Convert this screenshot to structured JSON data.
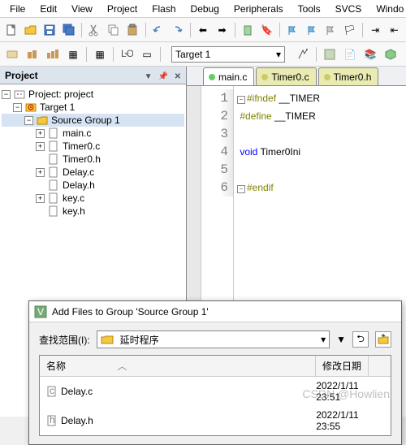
{
  "menu": [
    "File",
    "Edit",
    "View",
    "Project",
    "Flash",
    "Debug",
    "Peripherals",
    "Tools",
    "SVCS",
    "Windo"
  ],
  "target_label": "Target 1",
  "project_panel_title": "Project",
  "tree": {
    "root": "Project: project",
    "target": "Target 1",
    "group": "Source Group 1",
    "files": [
      "main.c",
      "Timer0.c",
      "Timer0.h",
      "Delay.c",
      "Delay.h",
      "key.c",
      "key.h"
    ]
  },
  "tabs": [
    {
      "label": "main.c",
      "active": false
    },
    {
      "label": "Timer0.c",
      "active": true
    },
    {
      "label": "Timer0.h",
      "active": false
    }
  ],
  "code_lines": [
    "1",
    "2",
    "3",
    "4",
    "5",
    "6"
  ],
  "code": {
    "l1a": "#ifndef",
    "l1b": " __TIMER",
    "l2a": "#define",
    "l2b": " __TIMER",
    "l4a": "void",
    "l4b": " Timer0Ini",
    "l6": "#endif"
  },
  "dialog": {
    "title": "Add Files to Group 'Source Group 1'",
    "lookin_label": "查找范围(I):",
    "lookin_value": "延时程序",
    "col_name": "名称",
    "col_date": "修改日期",
    "rows": [
      {
        "name": "Delay.c",
        "date": "2022/1/11 23:51"
      },
      {
        "name": "Delay.h",
        "date": "2022/1/11 23:55"
      }
    ]
  },
  "watermark": "CSDN @Howlien"
}
